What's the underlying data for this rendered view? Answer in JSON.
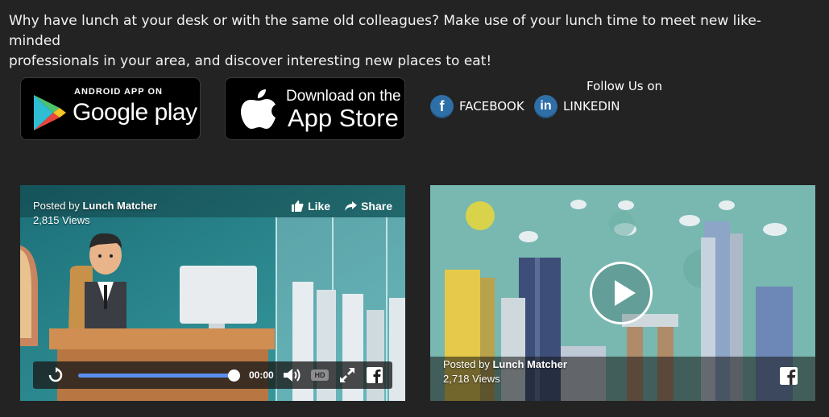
{
  "intro": {
    "line1": "Why have lunch at your desk or with the same old colleagues? Make use of your lunch time to meet new like-minded",
    "line2": "professionals in your area, and discover interesting new places to eat!"
  },
  "badges": {
    "google": {
      "small": "ANDROID APP ON",
      "big": "Google play",
      "icon": "google-play-icon"
    },
    "apple": {
      "small": "Download on the",
      "big": "App Store",
      "icon": "apple-icon"
    }
  },
  "follow": {
    "title": "Follow Us on",
    "facebook": {
      "letter": "f",
      "label": "FACEBOOK"
    },
    "linkedin": {
      "letter": "in",
      "label": "LINKEDIN"
    }
  },
  "videos": [
    {
      "posted_prefix": "Posted by ",
      "author": "Lunch Matcher",
      "views": "2,815 Views",
      "like": "Like",
      "share": "Share",
      "time": "00:00",
      "hd": "HD",
      "progress": 1.0
    },
    {
      "posted_prefix": "Posted by ",
      "author": "Lunch Matcher",
      "views": "2,718 Views"
    }
  ],
  "colors": {
    "page_bg": "#232323",
    "video1_bg": "#2a8f95",
    "video2_bg": "#78b8b0",
    "progress": "#5b8ef0",
    "social": "#2f6fa8"
  }
}
